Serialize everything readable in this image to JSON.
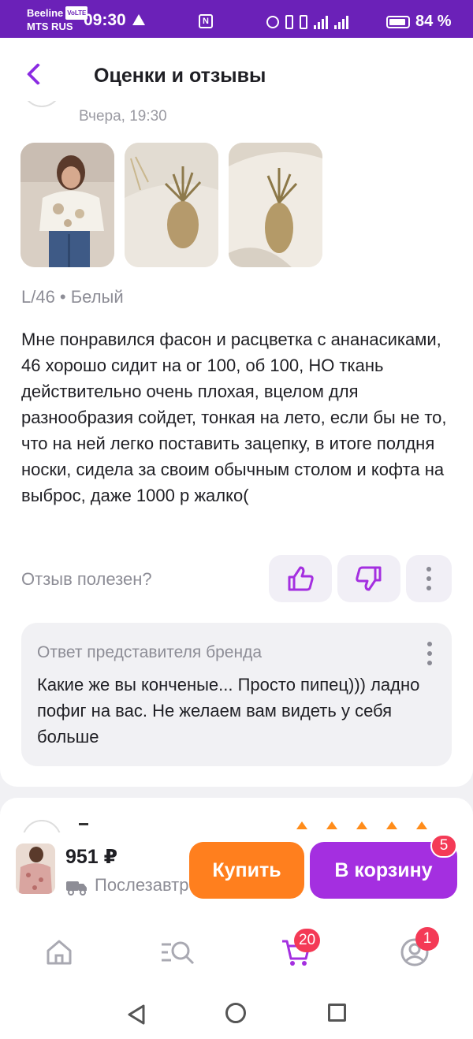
{
  "status_bar": {
    "carrier1": "Beeline",
    "volte": "VoLTE",
    "carrier2": "MTS RUS",
    "time": "09:30",
    "battery": "84 %",
    "network": "4G"
  },
  "header": {
    "title": "Оценки и отзывы",
    "back_icon": "chevron-left-icon"
  },
  "review": {
    "date": "Вчера, 19:30",
    "variant": "L/46 • Белый",
    "text": "Мне понравился фасон и расцветка с ананасиками, 46 хорошо сидит на ог 100, об 100, НО ткань действительно очень плохая, вцелом для разнообразия сойдет, тонкая на лето, если бы не то, что на ней легко поставить зацепку, в итоге полдня носки, сидела за своим обычным столом и кофта на выброс, даже 1000 р жалко(",
    "helpful_label": "Отзыв полезен?",
    "brand_reply": {
      "title": "Ответ представителя бренда",
      "text": "Какие же вы конченые... Просто пипец))) ладно пофиг на вас. Не желаем вам видеть у себя больше"
    }
  },
  "buy_bar": {
    "price": "951 ₽",
    "delivery": "Послезавтра",
    "buy_label": "Купить",
    "cart_label": "В корзину",
    "cart_badge": "5"
  },
  "bottom_nav": {
    "cart_badge": "20",
    "profile_badge": "1"
  },
  "colors": {
    "accent": "#a42fe0",
    "status_bar": "#6b21b8",
    "buy": "#ff7f1e",
    "badge": "#f43a56",
    "star": "#ff8c1a"
  }
}
